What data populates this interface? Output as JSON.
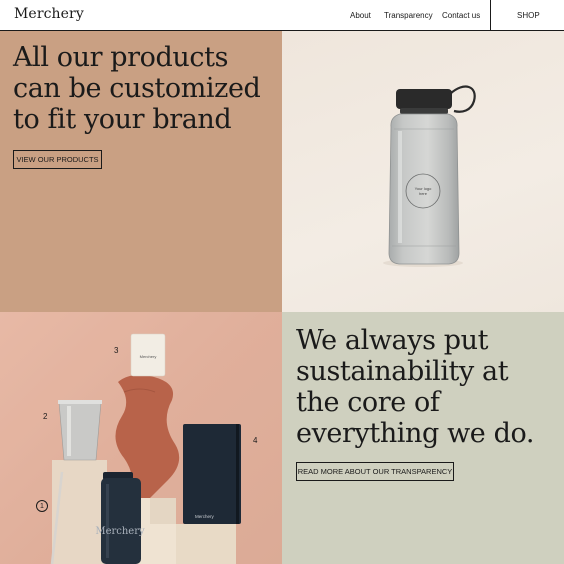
{
  "header": {
    "logo": "Merchery",
    "nav": {
      "about": "About",
      "transparency": "Transparency",
      "contact": "Contact us"
    },
    "shop": "SHOP"
  },
  "hero": {
    "headline": "All our products can be customized to fit your brand",
    "button": "VIEW OUR PRODUCTS"
  },
  "bottle_image": {
    "logo_placeholder": "Your logo here"
  },
  "products_image": {
    "callouts": [
      "1",
      "2",
      "3",
      "4"
    ],
    "candle_label": "Merchery",
    "notebook_label": "Merchery",
    "bottle_label": "Merchery"
  },
  "sustainability": {
    "headline": "We always put sustainability at the core of everything we do.",
    "button": "READ MORE ABOUT OUR TRANSPARENCY"
  },
  "colors": {
    "hero_bg": "#c9a083",
    "bottle_bg": "#f0e8df",
    "products_bg": "#e3b39f",
    "sustainability_bg": "#cfd0bf",
    "text": "#1a1a1a"
  }
}
